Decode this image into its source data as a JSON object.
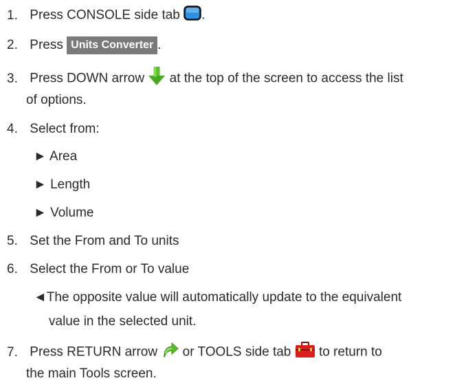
{
  "steps": [
    {
      "num": "1.",
      "a": "Press CONSOLE side tab",
      "b": "."
    },
    {
      "num": "2.",
      "a": "Press",
      "button": "Units Converter",
      "b": "."
    },
    {
      "num": "3.",
      "a": "Press DOWN arrow",
      "b": "at the top of the screen to access the list",
      "c": "of options."
    },
    {
      "num": "4.",
      "a": "Select from:"
    },
    {
      "num": "5.",
      "a": "Set the From and To units"
    },
    {
      "num": "6.",
      "a": "Select the From or To value"
    },
    {
      "num": "7.",
      "a": "Press RETURN arrow",
      "b": "or TOOLS side tab",
      "c": "to return to",
      "d": "the main Tools screen."
    }
  ],
  "options": [
    "► Area",
    "► Length",
    "► Volume"
  ],
  "note": {
    "line1": "◄The opposite value will automatically update to the equivalent",
    "line2": "value in the selected unit."
  },
  "icons": {
    "console": "console-tab-icon",
    "down": "down-arrow-icon",
    "return": "return-arrow-icon",
    "tools": "tools-toolbox-icon"
  },
  "colors": {
    "text": "#2a2a2a",
    "button_bg": "#7a7a7a",
    "console_blue": "#2f8fe0",
    "arrow_green": "#5bbf2a",
    "toolbox_red": "#d81e1e"
  }
}
